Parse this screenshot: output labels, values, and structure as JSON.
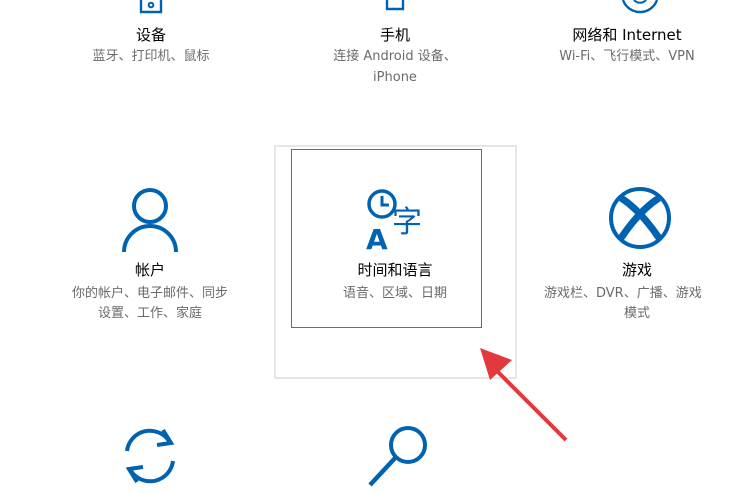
{
  "colors": {
    "accent": "#0063b1",
    "annotation": "#e4393c",
    "subtitle": "#6b6b6b"
  },
  "tiles": {
    "devices": {
      "icon": "devices-icon",
      "title": "设备",
      "subtitle": "蓝牙、打印机、鼠标"
    },
    "phone": {
      "icon": "phone-icon",
      "title": "手机",
      "subtitle_line1": "连接 Android 设备、",
      "subtitle_line2": "iPhone"
    },
    "network": {
      "icon": "globe-icon",
      "title": "网络和 Internet",
      "subtitle": "Wi-Fi、飞行模式、VPN"
    },
    "accounts": {
      "icon": "person-icon",
      "title": "帐户",
      "subtitle_line1": "你的帐户、电子邮件、同步",
      "subtitle_line2": "设置、工作、家庭"
    },
    "time_language": {
      "icon": "time-language-icon",
      "title": "时间和语言",
      "subtitle": "语音、区域、日期",
      "icon_glyph": "字",
      "icon_letter": "A"
    },
    "gaming": {
      "icon": "xbox-icon",
      "title": "游戏",
      "subtitle_line1": "游戏栏、DVR、广播、游戏",
      "subtitle_line2": "模式"
    },
    "update": {
      "icon": "sync-icon"
    },
    "search": {
      "icon": "search-icon"
    }
  }
}
